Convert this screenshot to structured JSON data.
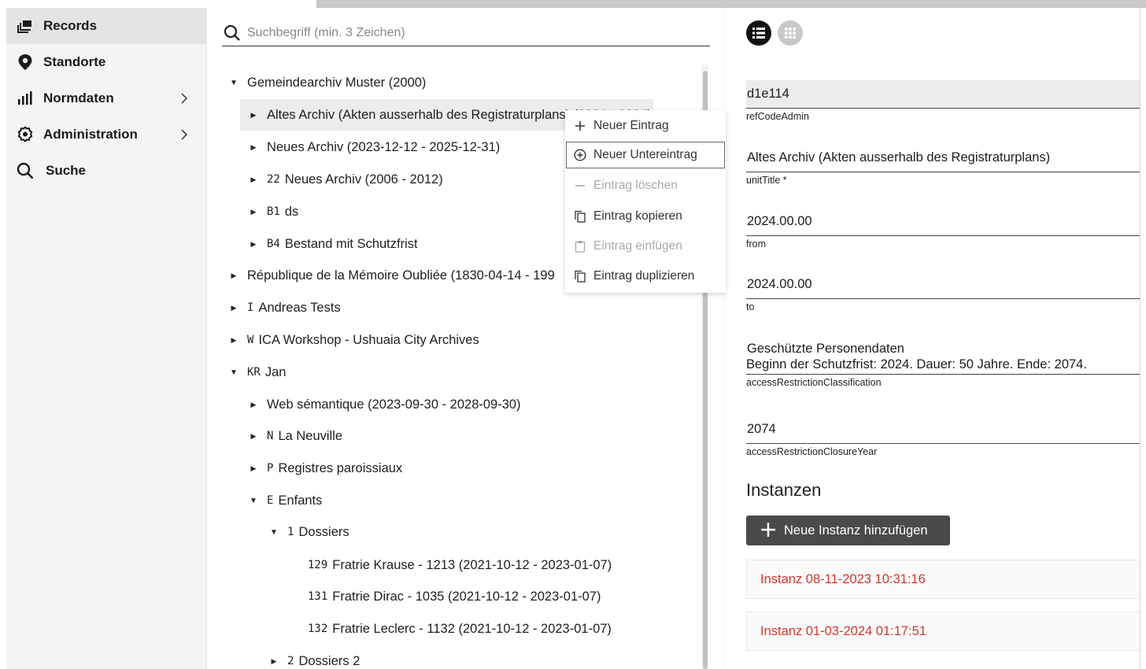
{
  "sidebar": {
    "items": [
      {
        "label": "Records",
        "icon": "records-icon",
        "active": true,
        "has_submenu": false
      },
      {
        "label": "Standorte",
        "icon": "location-icon",
        "active": false,
        "has_submenu": false
      },
      {
        "label": "Normdaten",
        "icon": "bar-chart-icon",
        "active": false,
        "has_submenu": true
      },
      {
        "label": "Administration",
        "icon": "gear-icon",
        "active": false,
        "has_submenu": true
      },
      {
        "label": "Suche",
        "icon": "search-icon",
        "active": false,
        "has_submenu": false
      }
    ]
  },
  "search": {
    "placeholder": "Suchbegriff (min. 3 Zeichen)",
    "value": ""
  },
  "tree": {
    "nodes": [
      {
        "code": "",
        "label": "Gemeindearchiv Muster (2000)",
        "state": "expanded"
      },
      {
        "code": "",
        "label": "Altes Archiv (Akten ausserhalb des Registraturplans) (2024 - 2024)",
        "state": "collapsed",
        "selected": true
      },
      {
        "code": "",
        "label": "Neues Archiv (2023-12-12 - 2025-12-31)",
        "state": "collapsed"
      },
      {
        "code": "22",
        "label": "Neues Archiv (2006 - 2012)",
        "state": "collapsed"
      },
      {
        "code": "B1",
        "label": "ds",
        "state": "collapsed"
      },
      {
        "code": "B4",
        "label": "Bestand mit Schutzfrist",
        "state": "collapsed"
      },
      {
        "code": "",
        "label": "République de la Mémoire Oubliée (1830-04-14 - 199",
        "state": "collapsed"
      },
      {
        "code": "I",
        "label": "Andreas Tests",
        "state": "collapsed"
      },
      {
        "code": "W",
        "label": "ICA Workshop - Ushuaia City Archives",
        "state": "collapsed"
      },
      {
        "code": "KR",
        "label": "Jan",
        "state": "expanded"
      },
      {
        "code": "",
        "label": "Web sémantique (2023-09-30 - 2028-09-30)",
        "state": "collapsed"
      },
      {
        "code": "N",
        "label": "La Neuville",
        "state": "collapsed"
      },
      {
        "code": "P",
        "label": "Registres paroissiaux",
        "state": "collapsed"
      },
      {
        "code": "E",
        "label": "Enfants",
        "state": "expanded"
      },
      {
        "code": "1",
        "label": "Dossiers",
        "state": "expanded"
      },
      {
        "code": "129",
        "label": "Fratrie Krause - 1213 (2021-10-12 - 2023-01-07)",
        "state": "leaf"
      },
      {
        "code": "131",
        "label": "Fratrie Dirac - 1035 (2021-10-12 - 2023-01-07)",
        "state": "leaf"
      },
      {
        "code": "132",
        "label": "Fratrie Leclerc - 1132 (2021-10-12 - 2023-01-07)",
        "state": "leaf"
      },
      {
        "code": "2",
        "label": "Dossiers 2",
        "state": "collapsed"
      }
    ]
  },
  "context_menu": {
    "items": [
      {
        "label": "Neuer Eintrag",
        "icon": "plus-icon",
        "enabled": true
      },
      {
        "label": "Neuer Untereintrag",
        "icon": "add-circle-icon",
        "enabled": true,
        "highlighted": true
      },
      {
        "label": "Eintrag löschen",
        "icon": "minus-icon",
        "enabled": false
      },
      {
        "label": "Eintrag kopieren",
        "icon": "copy-icon",
        "enabled": true
      },
      {
        "label": "Eintrag einfügen",
        "icon": "clipboard-icon",
        "enabled": false
      },
      {
        "label": "Eintrag duplizieren",
        "icon": "duplicate-icon",
        "enabled": true
      }
    ]
  },
  "detail": {
    "view_toggle": [
      {
        "icon": "list-view-icon",
        "active": true
      },
      {
        "icon": "grid-view-icon",
        "active": false
      }
    ],
    "fields": [
      {
        "value": "d1e114",
        "label": "refCodeAdmin"
      },
      {
        "value": "Altes Archiv (Akten ausserhalb des Registraturplans)",
        "label": "unitTitle *"
      },
      {
        "value": "2024.00.00",
        "label": "from"
      },
      {
        "value": "2024.00.00",
        "label": "to"
      },
      {
        "value": "Geschützte Personendaten",
        "label": "accessRestrictionClassification",
        "subtext": "Beginn der Schutzfrist: 2024. Dauer: 50 Jahre. Ende: 2074."
      },
      {
        "value": "2074",
        "label": "accessRestrictionClosureYear"
      }
    ],
    "instances_heading": "Instanzen",
    "add_instance_label": "Neue Instanz hinzufügen",
    "instances": [
      {
        "label": "Instanz 08-11-2023 10:31:16"
      },
      {
        "label": "Instanz 01-03-2024 01:17:51"
      }
    ]
  },
  "colors": {
    "instance_text": "#d6342b",
    "button_dark": "#4a4a4a",
    "sidebar_bg": "#f4f4f4",
    "selected_row_bg": "#ececec"
  }
}
